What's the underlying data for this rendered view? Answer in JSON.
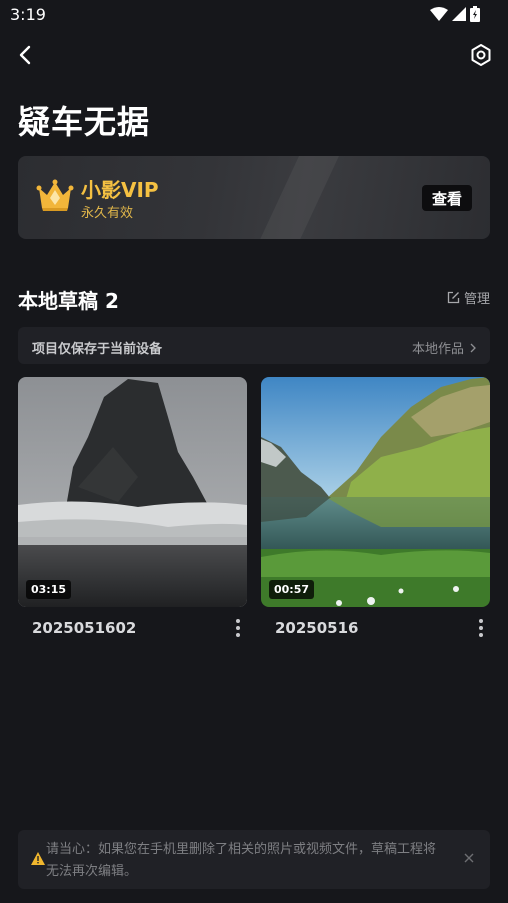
{
  "status_bar": {
    "time": "3:19"
  },
  "page": {
    "title": "疑车无据"
  },
  "vip": {
    "title": "小影VIP",
    "subtitle": "永久有效",
    "view_label": "查看"
  },
  "drafts_section": {
    "title": "本地草稿 2",
    "manage_label": "管理"
  },
  "info_bar": {
    "text": "项目仅保存于当前设备",
    "link_label": "本地作品"
  },
  "drafts": [
    {
      "name": "2025051602",
      "duration": "03:15"
    },
    {
      "name": "20250516",
      "duration": "00:57"
    }
  ],
  "warning": {
    "text": "请当心：如果您在手机里删除了相关的照片或视频文件，草稿工程将无法再次编辑。"
  },
  "colors": {
    "background": "#16171b",
    "vip_gold": "#f5c142",
    "card": "#202126"
  }
}
